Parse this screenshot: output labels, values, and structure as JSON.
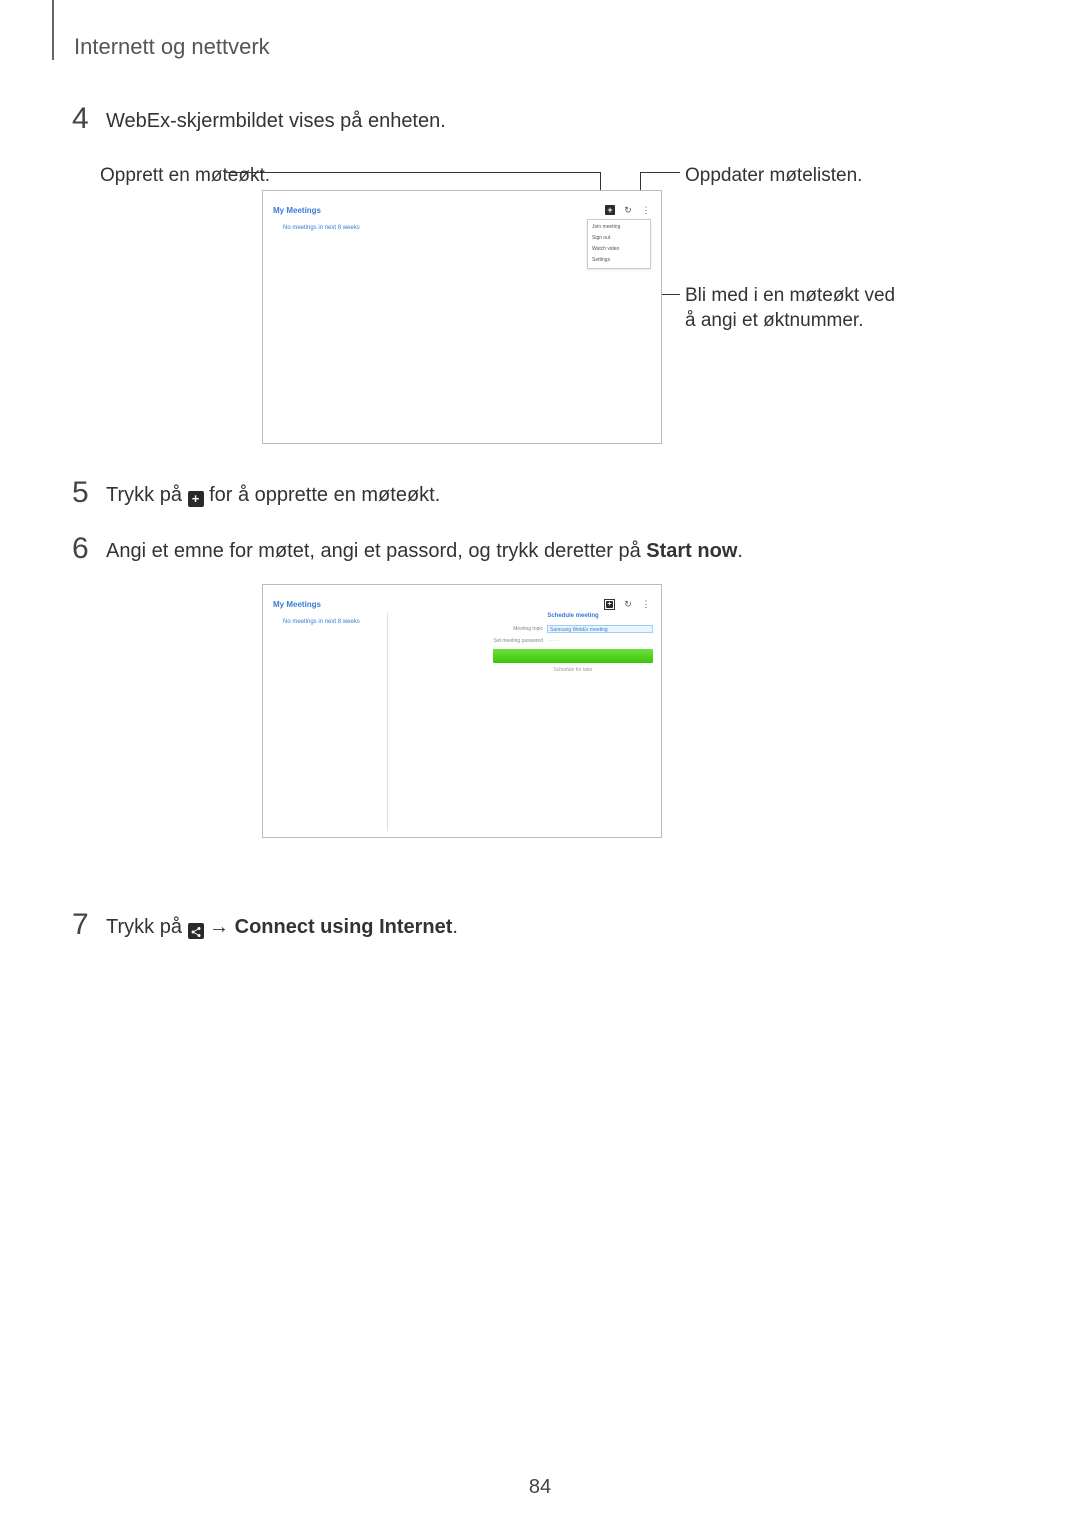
{
  "header": "Internett og nettverk",
  "steps": {
    "s4": {
      "num": "4",
      "text": "WebEx-skjermbildet vises på enheten."
    },
    "s5": {
      "num": "5",
      "pre": "Trykk på ",
      "post": " for å opprette en møteøkt."
    },
    "s6": {
      "num": "6",
      "text_pre": "Angi et emne for møtet, angi et passord, og trykk deretter på ",
      "bold": "Start now",
      "text_post": "."
    },
    "s7": {
      "num": "7",
      "pre": "Trykk på ",
      "arrow": " → ",
      "bold": "Connect using Internet",
      "post": "."
    }
  },
  "callouts": {
    "create": "Opprett en møteøkt.",
    "refresh": "Oppdater møtelisten.",
    "join": "Bli med i en møteøkt ved å angi et øktnummer."
  },
  "mock": {
    "title": "My Meetings",
    "subtext": "No meetings in next 8 weeks",
    "menu": [
      "Join meeting",
      "Sign out",
      "Watch video",
      "Settings"
    ]
  },
  "mock2": {
    "panel_title": "Schedule meeting",
    "topic_label": "Meeting topic",
    "topic_value": "Samsung WebEx meeting",
    "pw_label": "Set meeting password",
    "pw_value": "······",
    "sched": "Schedule for later"
  },
  "icons": {
    "plus": "+",
    "share": "share-icon"
  },
  "page_number": "84"
}
